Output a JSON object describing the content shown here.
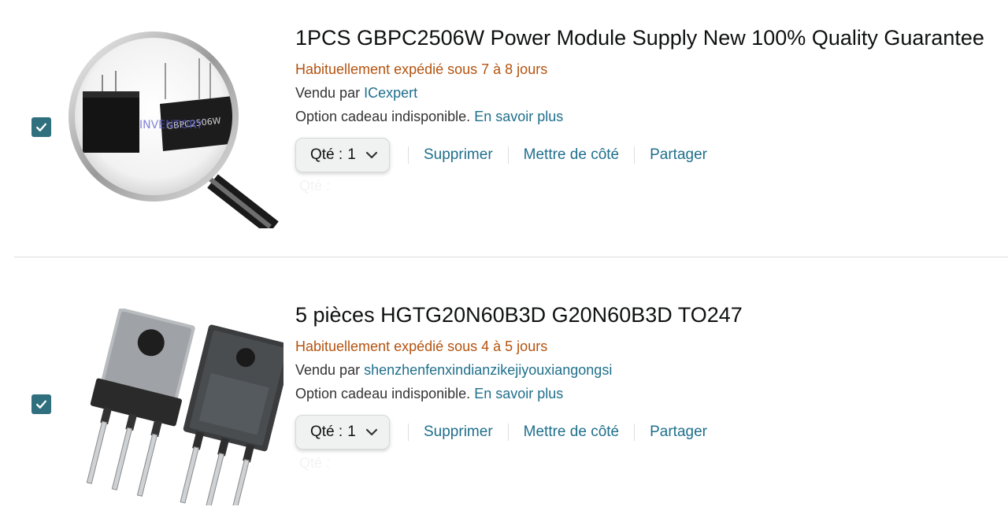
{
  "items": [
    {
      "title": "1PCS GBPC2506W Power Module Supply New 100% Quality Guarantee",
      "shipping": "Habituellement expédié sous 7 à 8 jours",
      "sold_by_prefix": "Vendu par",
      "seller": "ICexpert",
      "gift_text": "Option cadeau indisponible.",
      "gift_link": "En savoir plus",
      "qty_label": "Qté : ",
      "qty_value": "1",
      "ghost_text": "Qté :",
      "actions": [
        "Supprimer",
        "Mettre de côté",
        "Partager"
      ],
      "image_text": "GBPC2506W",
      "watermark": "INVENTORY",
      "checked": true
    },
    {
      "title": "5 pièces HGTG20N60B3D G20N60B3D TO247",
      "shipping": "Habituellement expédié sous 4 à 5 jours",
      "sold_by_prefix": "Vendu par",
      "seller": "shenzhenfenxindianzikejiyouxiangongsi",
      "gift_text": "Option cadeau indisponible.",
      "gift_link": "En savoir plus",
      "qty_label": "Qté : ",
      "qty_value": "1",
      "ghost_text": "Qté :",
      "actions": [
        "Supprimer",
        "Mettre de côté",
        "Partager"
      ],
      "checked": true
    }
  ],
  "colors": {
    "checkbox": "#2f6f7e",
    "link": "#1f6f8b",
    "shipping": "#b4530f",
    "divider": "#dddddd"
  },
  "icons": [
    "checkmark-icon",
    "chevron-down-icon"
  ]
}
